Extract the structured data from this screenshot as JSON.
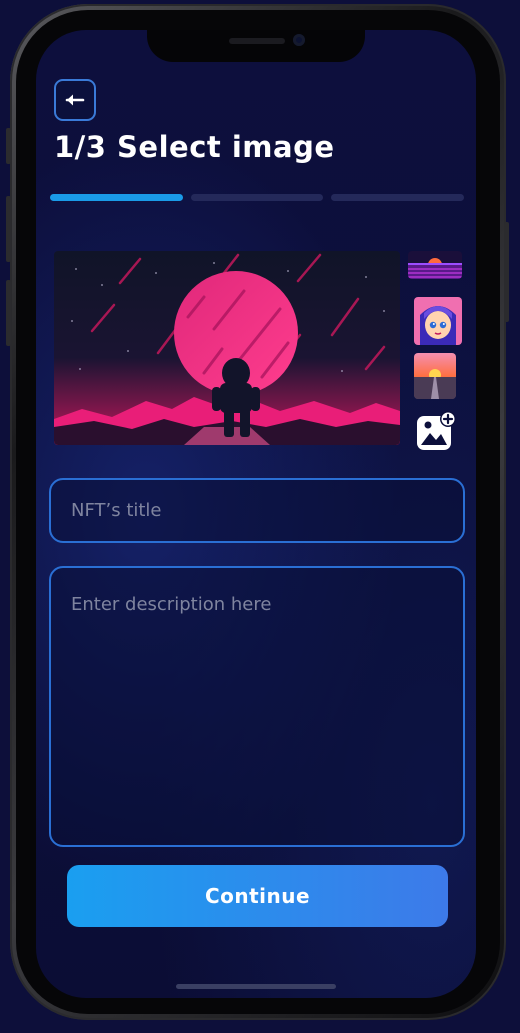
{
  "header": {
    "title": "1/3 Select image",
    "back_icon": "arrow-left-icon"
  },
  "progress": {
    "steps_total": 3,
    "current_step": 1
  },
  "gallery": {
    "thumbnails": [
      "synthwave-sunset-thumbnail",
      "anime-girl-avatar-thumbnail",
      "road-sunset-thumbnail"
    ],
    "add_icon": "add-image-icon"
  },
  "form": {
    "title_placeholder": "NFT’s title",
    "description_placeholder": "Enter description here"
  },
  "actions": {
    "continue_label": "Continue"
  },
  "colors": {
    "background": "#0c0f3b",
    "accent": "#1a9be8",
    "field_border": "#2a6fd4",
    "button_gradient_start": "#1a9ff0",
    "button_gradient_end": "#3d7ae9"
  }
}
